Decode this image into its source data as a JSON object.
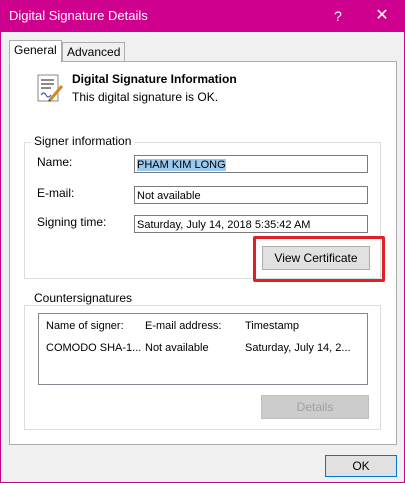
{
  "window": {
    "title": "Digital Signature Details",
    "help_glyph": "?",
    "close_glyph": "✕"
  },
  "tabs": [
    {
      "label": "General"
    },
    {
      "label": "Advanced"
    }
  ],
  "header": {
    "heading": "Digital Signature Information",
    "status": "This digital signature is OK."
  },
  "signer": {
    "group_label": "Signer information",
    "name_label": "Name:",
    "name_value": "PHAM KIM LONG",
    "email_label": "E-mail:",
    "email_value": "Not available",
    "time_label": "Signing time:",
    "time_value": "Saturday, July 14, 2018 5:35:42 AM",
    "view_certificate": "View Certificate"
  },
  "countersignatures": {
    "group_label": "Countersignatures",
    "columns": [
      "Name of signer:",
      "E-mail address:",
      "Timestamp"
    ],
    "rows": [
      [
        "COMODO SHA-1...",
        "Not available",
        "Saturday, July 14, 2..."
      ]
    ],
    "details_button": "Details"
  },
  "footer": {
    "ok": "OK"
  }
}
